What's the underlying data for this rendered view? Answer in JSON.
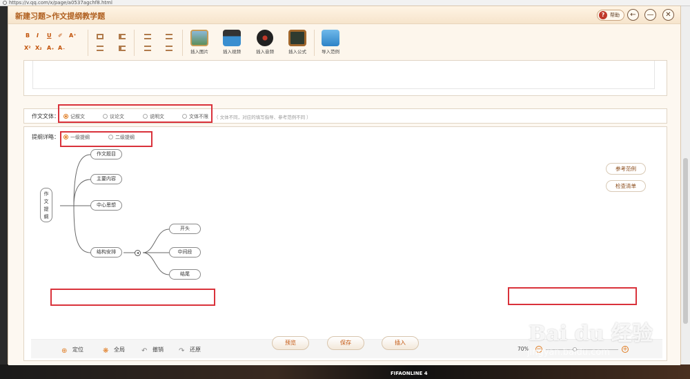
{
  "browser": {
    "url": "https://v.qq.com/x/page/a0537agchf8.html"
  },
  "window": {
    "title": "新建习题>作文提纲教学题",
    "help_label": "帮助",
    "back_glyph": "←",
    "minimize_glyph": "—",
    "close_glyph": "✕"
  },
  "toolbar": {
    "bold": "B",
    "italic": "I",
    "underline": "U",
    "eraser": "✐",
    "font_up": "A⁺",
    "superscript": "X²",
    "subscript": "X₂",
    "font_sub": "A₊",
    "font_down": "A₋",
    "insert_image": "插入图片",
    "insert_video": "插入视频",
    "insert_audio": "插入音频",
    "insert_formula": "插入公式",
    "import_example": "导入范例"
  },
  "form": {
    "genre_label": "作文文体：",
    "genre_options": [
      "记叙文",
      "议论文",
      "说明文",
      "文体不限"
    ],
    "genre_selected": "记叙文",
    "genre_hint": "（ 文体不同，对应的填写指导、参考范例不同 ）",
    "outline_label": "提纲详略：",
    "outline_options": [
      "一级提纲",
      "二级提纲"
    ],
    "outline_selected": "一级提纲"
  },
  "mindmap": {
    "root": [
      "作",
      "文",
      "提",
      "纲"
    ],
    "level1": [
      "作文题目",
      "主要内容",
      "中心思想",
      "结构安排"
    ],
    "level2": [
      "开头",
      "中间段",
      "结尾"
    ]
  },
  "side_buttons": {
    "example": "参考范例",
    "checklist": "检查清单"
  },
  "bottombar": {
    "locate": "定位",
    "overview": "全局",
    "undo": "撤销",
    "redo": "还原",
    "zoom_label": "70%",
    "zoom_minus": "−",
    "zoom_plus": "+",
    "zoom_value": 0.4
  },
  "footer": {
    "preview": "预览",
    "save": "保存",
    "insert": "插入"
  },
  "background": {
    "game_banner": "FIFAONLINE 4"
  },
  "watermark": {
    "main": "Bai du 经验",
    "sub": "jingyan.baidu.com"
  },
  "colors": {
    "accent": "#e07a1f",
    "title": "#b06020",
    "highlight_box": "#d9313a"
  }
}
